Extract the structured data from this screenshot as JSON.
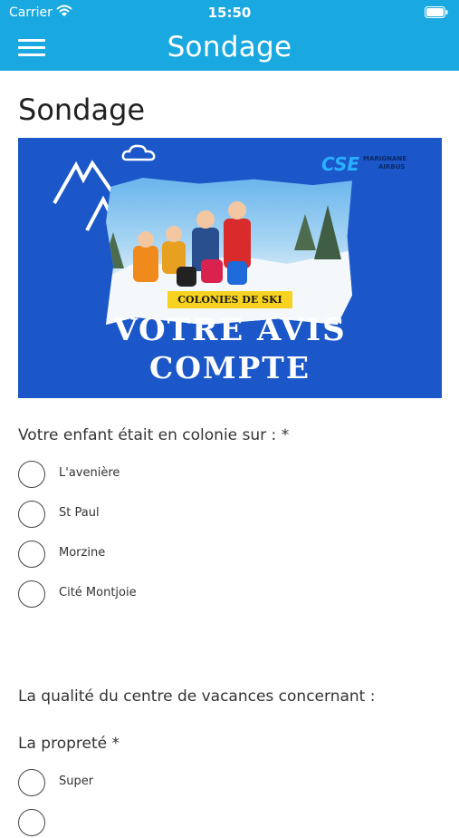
{
  "status_bar": {
    "carrier": "Carrier",
    "time": "15:50"
  },
  "nav": {
    "title": "Sondage",
    "menu_icon": "hamburger-menu-icon"
  },
  "page": {
    "title": "Sondage"
  },
  "banner": {
    "logo_text": "CSE",
    "logo_sub1": "MARIGNANE",
    "logo_sub2": "AIRBUS",
    "tag": "COLONIES DE SKI",
    "headline_line1": "VOTRE AVIS",
    "headline_line2": "COMPTE"
  },
  "questions": {
    "q1": {
      "label": "Votre enfant était en colonie sur : *",
      "options": [
        "L'avenière",
        "St Paul",
        "Morzine",
        "Cité Montjoie"
      ]
    },
    "section_label": "La qualité du centre de vacances concernant :",
    "q2": {
      "label": "La propreté *",
      "options": [
        "Super"
      ]
    }
  },
  "colors": {
    "header": "#1aa8e0",
    "banner": "#1b57c9",
    "tag": "#f7d21f"
  }
}
